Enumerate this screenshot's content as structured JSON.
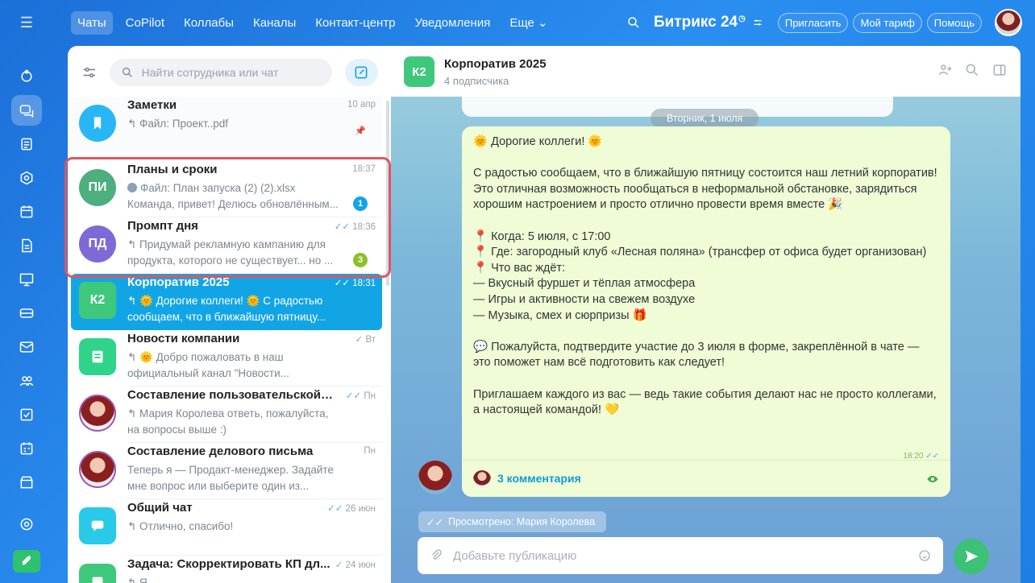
{
  "top_nav": {
    "tabs": [
      {
        "label": "Чаты",
        "active": true
      },
      {
        "label": "CoPilot"
      },
      {
        "label": "Коллабы"
      },
      {
        "label": "Каналы"
      },
      {
        "label": "Контакт-центр"
      },
      {
        "label": "Уведомления"
      },
      {
        "label": "Еще ⌄"
      }
    ],
    "brand": "Битрикс 24",
    "buttons": {
      "invite": "Пригласить",
      "tariff": "Мой тариф",
      "help": "Помощь"
    }
  },
  "rail_icons": [
    "feed-icon",
    "chats-icon",
    "tasks-icon",
    "copilot-icon",
    "calendar-icon",
    "docs-icon",
    "sites-icon",
    "crm-icon",
    "mail-icon",
    "employees-icon",
    "checklist-icon",
    "schedule-icon",
    "store-icon",
    "settings-icon",
    "rocket-icon"
  ],
  "chat_list": {
    "search_placeholder": "Найти сотрудника или чат",
    "chats": [
      {
        "title": "Заметки",
        "time": "10 апр",
        "line1": "↰ Файл: Проект..pdf",
        "line2": "",
        "avatar_text": "",
        "color": "#29b6f6"
      },
      {
        "title": "Планы и сроки",
        "time": "18:37",
        "line1": "Файл: План запуска (2) (2).xlsx",
        "line2": "Команда, привет! Делюсь обновлённым...",
        "avatar_text": "ПИ",
        "color": "#4caf7d",
        "badge": "1"
      },
      {
        "title": "Промпт дня",
        "time": "18:36",
        "line1": "↰ Придумай рекламную кампанию для",
        "line2": "продукта, которого не существует... но ...",
        "avatar_text": "ПД",
        "color": "#7e6ad6",
        "badge": "3"
      },
      {
        "title": "Корпоратив 2025",
        "time": "18:31",
        "line1": "↰ 🌞 Дорогие коллеги! 🌞 С радостью",
        "line2": "сообщаем, что в ближайшую пятницу...",
        "avatar_text": "К2",
        "color": "#3ec87b"
      },
      {
        "title": "Новости компании",
        "time": "Вт",
        "line1": "↰ 🌞 Добро пожаловать в наш",
        "line2": "официальный канал \"Новости...",
        "avatar_text": "",
        "color": "#2fd38a"
      },
      {
        "title": "Составление пользовательской ист...",
        "time": "Пн",
        "line1": "↰ Мария Королева ответь, пожалуйста,",
        "line2": "на вопросы выше :)",
        "avatar_text": "",
        "color": "#9b59b6"
      },
      {
        "title": "Составление делового письма",
        "time": "Пн",
        "line1": "Теперь я — Продакт-менеджер. Задайте",
        "line2": "мне вопрос или выберите один из...",
        "avatar_text": "",
        "color": "#9b59b6"
      },
      {
        "title": "Общий чат",
        "time": "26 июн",
        "line1": "↰ Отлично, спасибо!",
        "line2": "",
        "avatar_text": "",
        "color": "#29c9e8"
      },
      {
        "title": "Задача: Скорректировать КП дл...",
        "time": "24 июн",
        "line1": "↰ Я ...",
        "line2": "",
        "avatar_text": "",
        "color": "#3ec87b"
      }
    ]
  },
  "chat": {
    "name": "Корпоратив 2025",
    "avatar_text": "К2",
    "subscribers": "4 подписчика",
    "date_divider": "Вторник, 1 июля",
    "message_text": "🌞 Дорогие коллеги! 🌞\n\nС радостью сообщаем, что в ближайшую пятницу состоится наш летний корпоратив! Это отличная возможность пообщаться в неформальной обстановке, зарядиться хорошим настроением и просто отлично провести время вместе 🎉\n\n📍 Когда: 5 июля, с 17:00\n📍 Где: загородный клуб «Лесная поляна» (трансфер от офиса будет организован)\n📍 Что вас ждёт:\n— Вкусный фуршет и тёплая атмосфера\n— Игры и активности на свежем воздухе\n— Музыка, смех и сюрпризы 🎁\n\n💬 Пожалуйста, подтвердите участие до 3 июля в форме, закреплённой в чате — это поможет нам всё подготовить как следует!\n\nПриглашаем каждого из вас — ведь такие события делают нас не просто коллегами, а настоящей командой! 💛",
    "message_time": "18:20",
    "comments": "3 комментария",
    "seen_by": "Просмотрено: Мария Королева",
    "composer_placeholder": "Добавьте публикацию"
  }
}
